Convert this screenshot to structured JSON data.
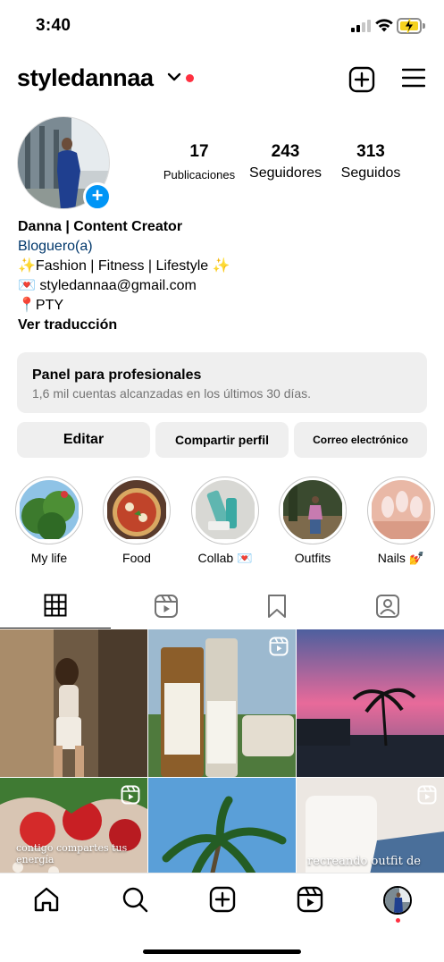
{
  "status_bar": {
    "time": "3:40"
  },
  "header": {
    "username": "styledannaa"
  },
  "profile": {
    "stats": [
      {
        "value": "17",
        "label": "Publicaciones"
      },
      {
        "value": "243",
        "label": "Seguidores"
      },
      {
        "value": "313",
        "label": "Seguidos"
      }
    ],
    "bio": {
      "name": "Danna | Content Creator",
      "category": "Bloguero(a)",
      "line1": "✨Fashion | Fitness | Lifestyle ✨",
      "email": "💌 styledannaa@gmail.com",
      "location": "📍PTY",
      "translate": "Ver traducción"
    }
  },
  "pro_panel": {
    "title": "Panel para profesionales",
    "subtitle": "1,6 mil cuentas alcanzadas en los últimos 30 días."
  },
  "buttons": {
    "edit": "Editar",
    "share": "Compartir perfil",
    "email": "Correo electrónico"
  },
  "highlights": [
    {
      "label": "My life"
    },
    {
      "label": "Food"
    },
    {
      "label": "Collab 💌"
    },
    {
      "label": "Outfits"
    },
    {
      "label": "Nails 💅"
    }
  ],
  "tabs": [
    "posts-grid",
    "reels",
    "saved",
    "tagged"
  ],
  "grid": {
    "captions": {
      "post4": "contigo compartes tus energía",
      "post6": "recreando outfit de"
    }
  },
  "nav": [
    "home",
    "search",
    "create",
    "reels",
    "profile"
  ],
  "colors": {
    "accent": "#0095f6",
    "notification": "#ff3040",
    "link": "#00376b",
    "panel_bg": "#efefef"
  }
}
